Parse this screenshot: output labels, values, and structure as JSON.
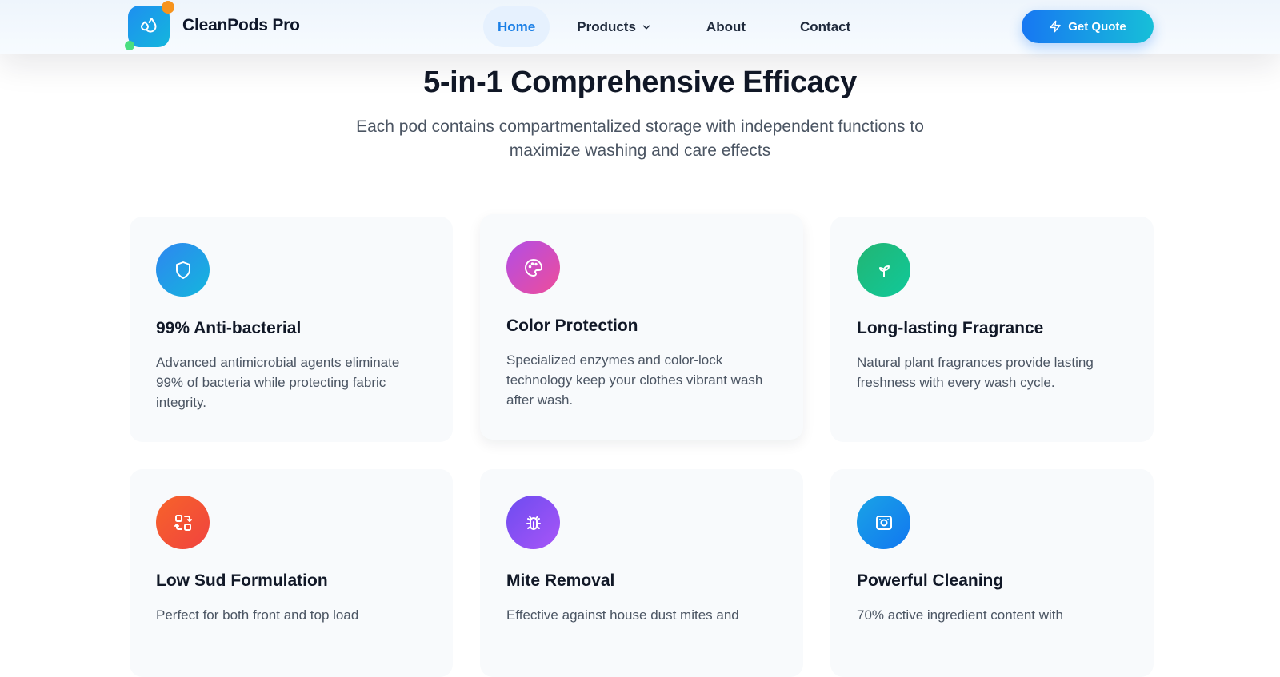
{
  "header": {
    "brand": "CleanPods Pro",
    "nav": {
      "home": "Home",
      "products": "Products",
      "about": "About",
      "contact": "Contact"
    },
    "cta_label": "Get Quote"
  },
  "section": {
    "title": "5-in-1 Comprehensive Efficacy",
    "subtitle": "Each pod contains compartmentalized storage with independent functions to maximize washing and care effects"
  },
  "features": [
    {
      "icon": "shield-icon",
      "title": "99% Anti-bacterial",
      "desc": "Advanced antimicrobial agents eliminate 99% of bacteria while protecting fabric integrity."
    },
    {
      "icon": "palette-icon",
      "title": "Color Protection",
      "desc": "Specialized enzymes and color-lock technology keep your clothes vibrant wash after wash."
    },
    {
      "icon": "sprout-icon",
      "title": "Long-lasting Fragrance",
      "desc": "Natural plant fragrances provide lasting freshness with every wash cycle."
    },
    {
      "icon": "swap-icon",
      "title": "Low Sud Formulation",
      "desc": "Perfect for both front and top load"
    },
    {
      "icon": "bug-icon",
      "title": "Mite Removal",
      "desc": "Effective against house dust mites and"
    },
    {
      "icon": "washing-machine-icon",
      "title": "Powerful Cleaning",
      "desc": "70% active ingredient content with"
    }
  ],
  "colors": {
    "accent": "#1a7fe6",
    "text_dark": "#111827",
    "text_muted": "#4b5563",
    "card_bg": "#f8fafc"
  }
}
